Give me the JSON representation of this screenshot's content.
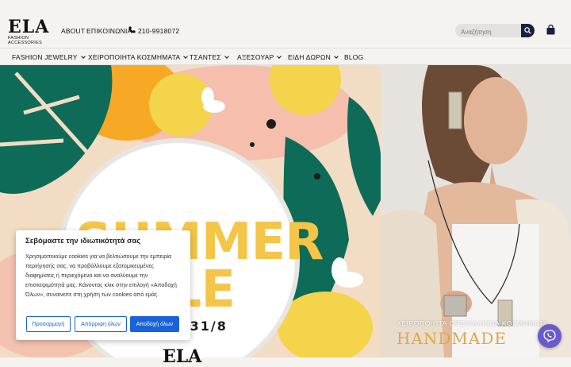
{
  "logo": {
    "main": "ELA",
    "sub": "FASHION ACCESSORIES"
  },
  "toplinks": {
    "about": "ABOUT",
    "contact": "ΕΠΙΚΟΙΝΩΝΙΑ",
    "phone": "210-9918072"
  },
  "search": {
    "placeholder": "Αναζήτηση"
  },
  "nav": [
    "FASHION JEWELRY",
    "ΧΕΙΡΟΠΟΙΗΤΑ ΚΟΣΜΗΜΑΤΑ",
    "ΤΣΑΝΤΕΣ",
    "ΑΞΕΣΟΥΑΡ",
    "ΕΙΔΗ ΔΩΡΩΝ",
    "BLOG"
  ],
  "hero_left": {
    "line1": "SUMMER",
    "line2": "ALE",
    "dates": "· 31/8",
    "brand": "ELA"
  },
  "hero_right": {
    "subtitle": "ΧΕΙΡΟΠΟΙΗΤΑ ΟΡΕΙΧΑΛΚΙΝΑ ΚΟΣΜΗΜΑΤΑ",
    "title": "HANDMADE"
  },
  "cookie": {
    "title": "Σεβόμαστε την ιδιωτικότητά σας",
    "text": "Χρησιμοποιούμε cookies για να βελτιώσουμε την εμπειρία περιήγησής σας, να προβάλλουμε εξατομικευμένες διαφημίσεις ή περιεχόμενο και να αναλύουμε την επισκεψιμότητά μας. Κάνοντας κλικ στην επιλογή «Αποδοχή Όλων», συναινείτε στη χρήση των cookies από εμάς.",
    "customize": "Προσαρμογή",
    "reject": "Απόρριψη όλων",
    "accept": "Αποδοχή όλων"
  },
  "colors": {
    "accent_blue": "#1863dc",
    "search_btn": "#1d1d3f",
    "chat": "#6a5acd"
  }
}
